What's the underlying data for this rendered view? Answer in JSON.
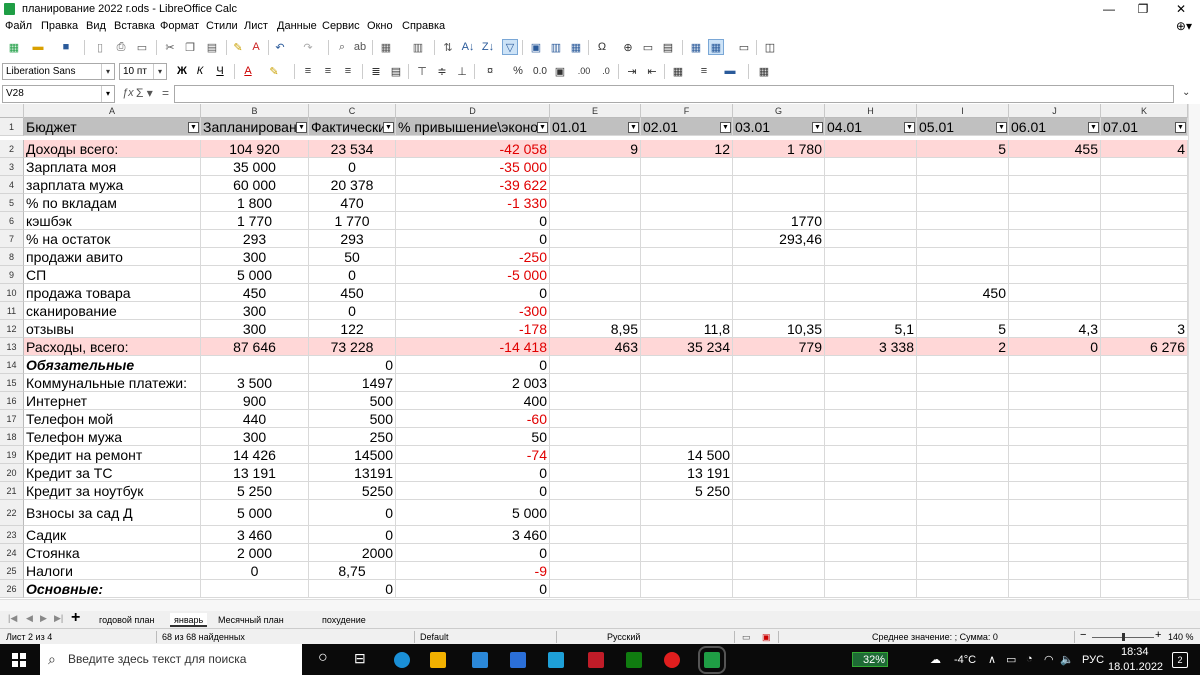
{
  "window": {
    "title": "планирование 2022 г.ods - LibreOffice Calc",
    "min": "—",
    "max": "❐",
    "close": "✕"
  },
  "menu": [
    "Файл",
    "Правка",
    "Вид",
    "Вставка",
    "Формат",
    "Стили",
    "Лист",
    "Данные",
    "Сервис",
    "Окно",
    "Справка"
  ],
  "toolbar2": {
    "font": "Liberation Sans",
    "size": "10 пт",
    "bold": "Ж",
    "italic": "К",
    "underline": "Ч",
    "percent": "%",
    "decimals": "0.0"
  },
  "formula": {
    "cell_ref": "V28",
    "value": ""
  },
  "columns": [
    {
      "letter": "A"
    },
    {
      "letter": "B"
    },
    {
      "letter": "C"
    },
    {
      "letter": "D"
    },
    {
      "letter": "E"
    },
    {
      "letter": "F"
    },
    {
      "letter": "G"
    },
    {
      "letter": "H"
    },
    {
      "letter": "I"
    },
    {
      "letter": "J"
    },
    {
      "letter": "K"
    }
  ],
  "rows": [
    {
      "n": "1",
      "cells": [
        "Бюджет",
        "Запланирован",
        "Фактически",
        "% привышение\\эконо",
        "01.01",
        "02.01",
        "03.01",
        "04.01",
        "05.01",
        "06.01",
        "07.01"
      ],
      "style": "header"
    },
    {
      "n": "2",
      "cells": [
        "Доходы всего:",
        "104 920",
        "23 534",
        "-42 058",
        "9",
        "12",
        "1 780",
        "",
        "5",
        "455",
        "4"
      ],
      "style": "pink"
    },
    {
      "n": "3",
      "cells": [
        "Зарплата моя",
        "35 000",
        "0",
        "-35 000",
        "",
        "",
        "",
        "",
        "",
        "",
        ""
      ]
    },
    {
      "n": "4",
      "cells": [
        "зарплата мужа",
        "60 000",
        "20 378",
        "-39 622",
        "",
        "",
        "",
        "",
        "",
        "",
        ""
      ]
    },
    {
      "n": "5",
      "cells": [
        "% по вкладам",
        "1 800",
        "470",
        "-1 330",
        "",
        "",
        "",
        "",
        "",
        "",
        ""
      ]
    },
    {
      "n": "6",
      "cells": [
        "кэшбэк",
        "1 770",
        "1 770",
        "0",
        "",
        "",
        "1770",
        "",
        "",
        "",
        ""
      ]
    },
    {
      "n": "7",
      "cells": [
        "% на остаток",
        "293",
        "293",
        "0",
        "",
        "",
        "293,46",
        "",
        "",
        "",
        ""
      ]
    },
    {
      "n": "8",
      "cells": [
        "продажи авито",
        "300",
        "50",
        "-250",
        "",
        "",
        "",
        "",
        "",
        "",
        ""
      ]
    },
    {
      "n": "9",
      "cells": [
        "СП",
        "5 000",
        "0",
        "-5 000",
        "",
        "",
        "",
        "",
        "",
        "",
        ""
      ]
    },
    {
      "n": "10",
      "cells": [
        "продажа товара",
        "450",
        "450",
        "0",
        "",
        "",
        "",
        "",
        "450",
        "",
        ""
      ]
    },
    {
      "n": "11",
      "cells": [
        "сканирование",
        "300",
        "0",
        "-300",
        "",
        "",
        "",
        "",
        "",
        "",
        ""
      ]
    },
    {
      "n": "12",
      "cells": [
        "отзывы",
        "300",
        "122",
        "-178",
        "8,95",
        "11,8",
        "10,35",
        "5,1",
        "5",
        "4,3",
        "3"
      ]
    },
    {
      "n": "13",
      "cells": [
        "Расходы, всего:",
        "87 646",
        "73 228",
        "-14 418",
        "463",
        "35 234",
        "779",
        "3 338",
        "2",
        "0",
        "6 276"
      ],
      "style": "pink"
    },
    {
      "n": "14",
      "cells": [
        "Обязательные",
        "",
        "0",
        "0",
        "",
        "",
        "",
        "",
        "",
        "",
        ""
      ],
      "bi": true
    },
    {
      "n": "15",
      "cells": [
        "Коммунальные платежи:",
        "3 500",
        "1497",
        "2 003",
        "",
        "",
        "",
        "",
        "",
        "",
        ""
      ]
    },
    {
      "n": "16",
      "cells": [
        "Интернет",
        "900",
        "500",
        "400",
        "",
        "",
        "",
        "",
        "",
        "",
        ""
      ]
    },
    {
      "n": "17",
      "cells": [
        "Телефон мой",
        "440",
        "500",
        "-60",
        "",
        "",
        "",
        "",
        "",
        "",
        ""
      ]
    },
    {
      "n": "18",
      "cells": [
        "Телефон мужа",
        "300",
        "250",
        "50",
        "",
        "",
        "",
        "",
        "",
        "",
        ""
      ]
    },
    {
      "n": "19",
      "cells": [
        "Кредит на ремонт",
        "14 426",
        "14500",
        "-74",
        "",
        "14 500",
        "",
        "",
        "",
        "",
        ""
      ]
    },
    {
      "n": "20",
      "cells": [
        "Кредит за ТС",
        "13 191",
        "13191",
        "0",
        "",
        "13 191",
        "",
        "",
        "",
        "",
        ""
      ]
    },
    {
      "n": "21",
      "cells": [
        "Кредит за ноутбук",
        "5 250",
        "5250",
        "0",
        "",
        "5 250",
        "",
        "",
        "",
        "",
        ""
      ]
    },
    {
      "n": "22",
      "cells": [
        "Взносы за сад Д",
        "5 000",
        "0",
        "5 000",
        "",
        "",
        "",
        "",
        "",
        "",
        ""
      ]
    },
    {
      "n": "23",
      "cells": [
        "Садик",
        "3 460",
        "0",
        "3 460",
        "",
        "",
        "",
        "",
        "",
        "",
        ""
      ]
    },
    {
      "n": "24",
      "cells": [
        "Стоянка",
        "2 000",
        "2000",
        "0",
        "",
        "",
        "",
        "",
        "",
        "",
        ""
      ]
    },
    {
      "n": "25",
      "cells": [
        "Налоги",
        "0",
        "8,75",
        "-9",
        "",
        "",
        "",
        "",
        "",
        "",
        ""
      ]
    },
    {
      "n": "26",
      "cells": [
        "Основные:",
        "",
        "0",
        "0",
        "",
        "",
        "",
        "",
        "",
        "",
        ""
      ],
      "bi": true
    }
  ],
  "tabs": {
    "add": "+",
    "items": [
      "годовой план",
      "январь",
      "Месячный план",
      "похудение"
    ],
    "active": 1
  },
  "status": {
    "sheet": "Лист 2 из 4",
    "found": "68 из 68 найденных",
    "style": "Default",
    "lang": "Русский",
    "summary": "Среднее значение: ; Сумма: 0",
    "zoom": "140 %"
  },
  "taskbar": {
    "search": "Введите здесь текст для поиска",
    "cpu": "32%",
    "temp": "-4°C",
    "lang": "РУС",
    "time": "18:34",
    "date": "18.01.2022",
    "notif": "2"
  },
  "colors": {
    "header_bg": "#c0c0c0",
    "pink": "#ffd7d7",
    "negative": "#e00000",
    "taskbar": "#0a0a0a"
  }
}
